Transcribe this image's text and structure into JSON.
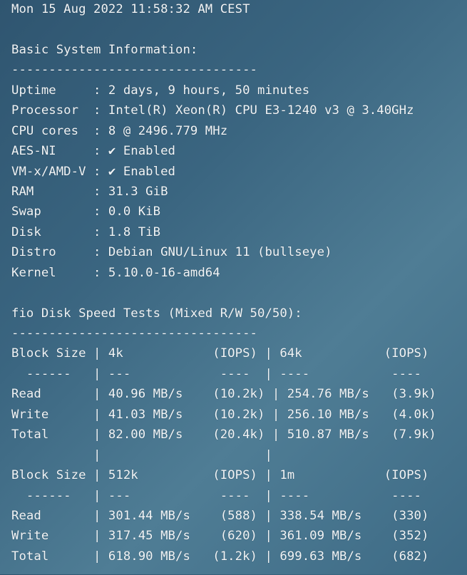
{
  "terminal": {
    "lines": [
      "Mon 15 Aug 2022 11:58:32 AM CEST",
      "",
      "Basic System Information:",
      "---------------------------------",
      "Uptime     : 2 days, 9 hours, 50 minutes",
      "Processor  : Intel(R) Xeon(R) CPU E3-1240 v3 @ 3.40GHz",
      "CPU cores  : 8 @ 2496.779 MHz",
      "AES-NI     : ✔ Enabled",
      "VM-x/AMD-V : ✔ Enabled",
      "RAM        : 31.3 GiB",
      "Swap       : 0.0 KiB",
      "Disk       : 1.8 TiB",
      "Distro     : Debian GNU/Linux 11 (bullseye)",
      "Kernel     : 5.10.0-16-amd64",
      "",
      "fio Disk Speed Tests (Mixed R/W 50/50):",
      "---------------------------------",
      "Block Size | 4k            (IOPS) | 64k           (IOPS)",
      "  ------   | ---            ----  | ----           ----",
      "Read       | 40.96 MB/s    (10.2k) | 254.76 MB/s   (3.9k)",
      "Write      | 41.03 MB/s    (10.2k) | 256.10 MB/s   (4.0k)",
      "Total      | 82.00 MB/s    (20.4k) | 510.87 MB/s   (7.9k)",
      "           |                      |",
      "Block Size | 512k          (IOPS) | 1m            (IOPS)",
      "  ------   | ---            ----  | ----           ----",
      "Read       | 301.44 MB/s    (588) | 338.54 MB/s    (330)",
      "Write      | 317.45 MB/s    (620) | 361.09 MB/s    (352)",
      "Total      | 618.90 MB/s   (1.2k) | 699.63 MB/s    (682)"
    ]
  }
}
